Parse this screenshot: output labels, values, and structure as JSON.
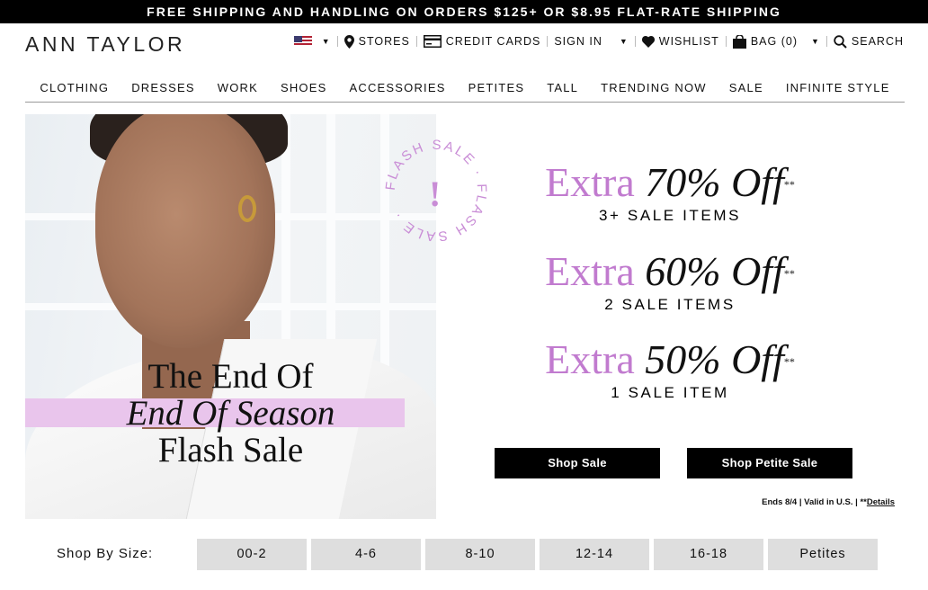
{
  "promo_bar": {
    "text": "FREE SHIPPING AND HANDLING ON ORDERS $125+ OR $8.95 FLAT-RATE SHIPPING"
  },
  "header": {
    "logo": "ANN TAYLOR",
    "utility": {
      "stores": "STORES",
      "credit_cards": "CREDIT CARDS",
      "sign_in": "SIGN IN",
      "wishlist": "WISHLIST",
      "bag": "BAG (0)",
      "search": "SEARCH"
    },
    "icons": [
      "us-flag-icon",
      "map-pin-icon",
      "credit-card-icon",
      "heart-icon",
      "bag-icon",
      "search-icon"
    ]
  },
  "nav": {
    "items": [
      "CLOTHING",
      "DRESSES",
      "WORK",
      "SHOES",
      "ACCESSORIES",
      "PETITES",
      "TALL",
      "TRENDING NOW",
      "SALE",
      "INFINITE STYLE"
    ]
  },
  "hero": {
    "stamp_text": "FLASH SALE · FLASH SALE ·",
    "stamp_mark": "!",
    "title_line1": "The End Of",
    "title_line2": "End Of Season",
    "title_line3": "Flash Sale",
    "colors": {
      "accent": "#c17bcf",
      "highlight": "#e9c5ec"
    }
  },
  "offers": [
    {
      "extra": "Extra",
      "percent": "70% Off",
      "mark": "**",
      "detail": "3+ SALE ITEMS"
    },
    {
      "extra": "Extra",
      "percent": "60% Off",
      "mark": "**",
      "detail": "2 SALE ITEMS"
    },
    {
      "extra": "Extra",
      "percent": "50% Off",
      "mark": "**",
      "detail": "1 SALE ITEM"
    }
  ],
  "buttons": {
    "shop_sale": "Shop Sale",
    "shop_petite_sale": "Shop Petite Sale"
  },
  "terms": {
    "text": "Ends 8/4 | Valid in U.S. | **",
    "details_link": "Details"
  },
  "shop_by_size": {
    "label": "Shop By Size:",
    "sizes": [
      "00-2",
      "4-6",
      "8-10",
      "12-14",
      "16-18",
      "Petites"
    ]
  }
}
